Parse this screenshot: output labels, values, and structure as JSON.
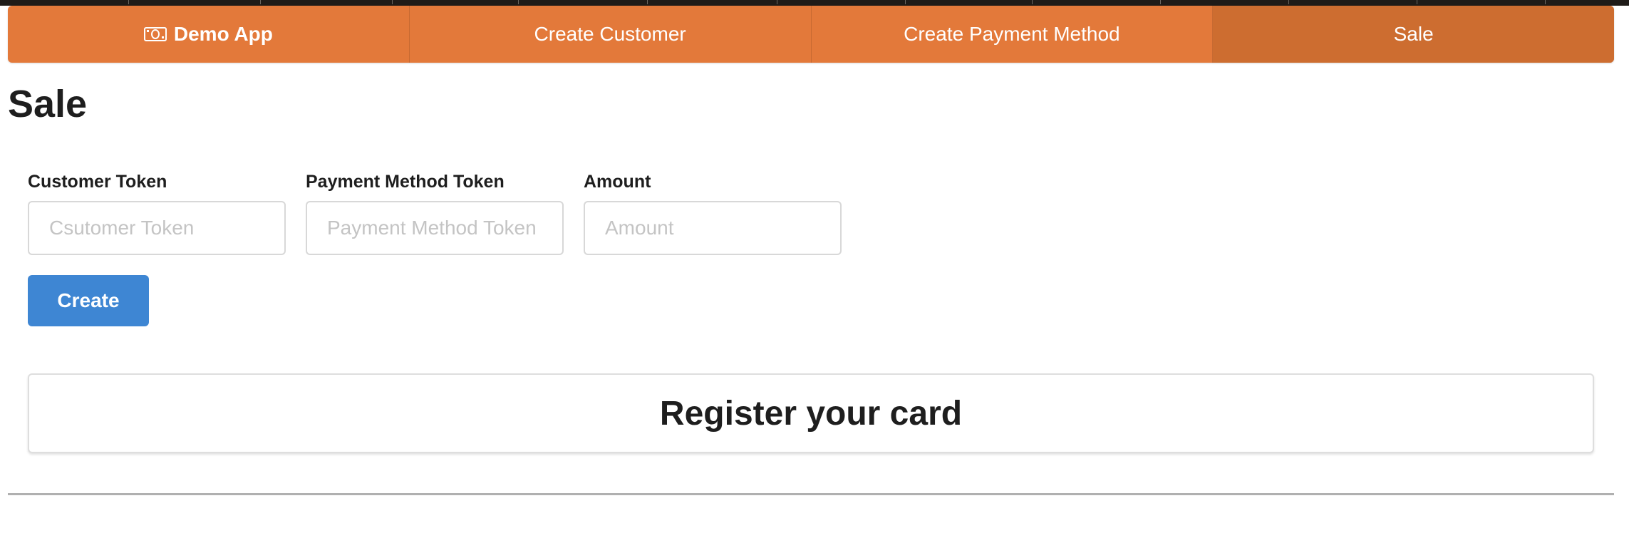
{
  "menu": {
    "brand_label": "Demo App",
    "brand_icon": "money-bill-icon",
    "items": [
      {
        "label": "Create Customer"
      },
      {
        "label": "Create Payment Method"
      },
      {
        "label": "Sale"
      }
    ],
    "active_item": "Sale",
    "accent_color": "#e3793a",
    "active_color": "#cd6d30"
  },
  "page": {
    "title": "Sale"
  },
  "form": {
    "fields": [
      {
        "label": "Customer Token",
        "placeholder": "Csutomer Token",
        "value": ""
      },
      {
        "label": "Payment Method Token",
        "placeholder": "Payment Method Token",
        "value": ""
      },
      {
        "label": "Amount",
        "placeholder": "Amount",
        "value": ""
      }
    ],
    "submit_label": "Create",
    "submit_color": "#3e86d3"
  },
  "card_section": {
    "heading": "Register your card"
  }
}
